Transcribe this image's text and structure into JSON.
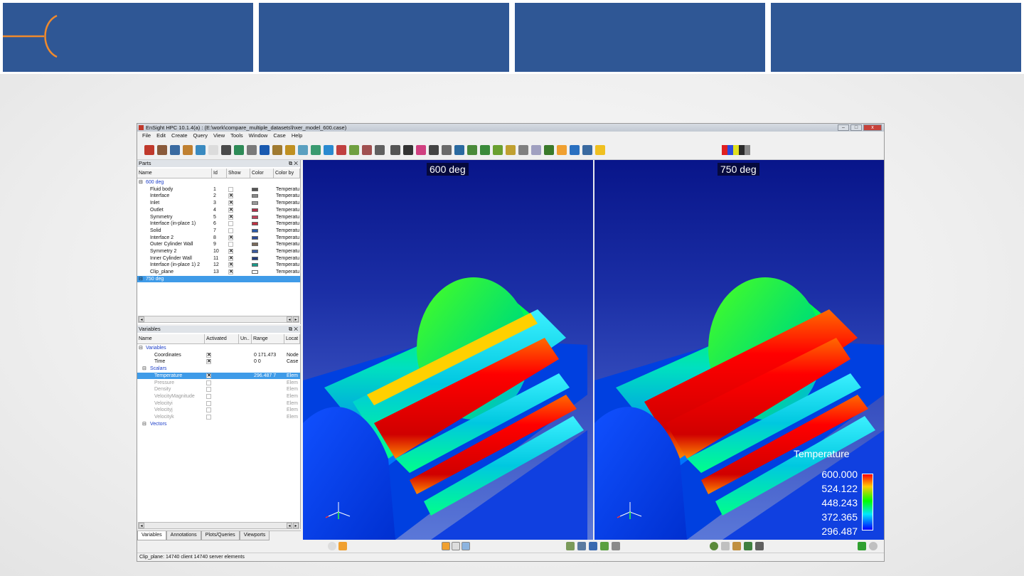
{
  "window": {
    "title": "EnSight HPC 10.1.4(a) :  (E:\\work\\compare_multiple_datasets\\hxer_model_600.case)"
  },
  "menu": [
    "File",
    "Edit",
    "Create",
    "Query",
    "View",
    "Tools",
    "Window",
    "Case",
    "Help"
  ],
  "parts": {
    "title": "Parts",
    "columns": [
      "Name",
      "Id",
      "Show",
      "Color",
      "Color by"
    ],
    "groups": [
      {
        "label": "600 deg",
        "selected": false
      },
      {
        "label": "750 deg",
        "selected": true
      }
    ],
    "rows": [
      {
        "name": "Fluid body",
        "id": "1",
        "show": false,
        "color": "#555555",
        "color_by": "Temperatu"
      },
      {
        "name": "Interface",
        "id": "2",
        "show": true,
        "color": "#8a8a8a",
        "color_by": "Temperatu"
      },
      {
        "name": "Inlet",
        "id": "3",
        "show": true,
        "color": "#9a9a9a",
        "color_by": "Temperatu"
      },
      {
        "name": "Outlet",
        "id": "4",
        "show": true,
        "color": "#b0304a",
        "color_by": "Temperatu"
      },
      {
        "name": "Symmetry",
        "id": "5",
        "show": true,
        "color": "#c0405a",
        "color_by": "Temperatu"
      },
      {
        "name": "Interface (in-place 1)",
        "id": "6",
        "show": false,
        "color": "#c03040",
        "color_by": "Temperatu"
      },
      {
        "name": "Solid",
        "id": "7",
        "show": false,
        "color": "#2a5aa8",
        "color_by": "Temperatu"
      },
      {
        "name": "Interface 2",
        "id": "8",
        "show": true,
        "color": "#2a4a98",
        "color_by": "Temperatu"
      },
      {
        "name": "Outer Cylinder Wall",
        "id": "9",
        "show": false,
        "color": "#7a6a5a",
        "color_by": "Temperatu"
      },
      {
        "name": "Symmetry 2",
        "id": "10",
        "show": true,
        "color": "#3a5aa0",
        "color_by": "Temperatu"
      },
      {
        "name": "Inner Cylinder Wall",
        "id": "11",
        "show": true,
        "color": "#223a78",
        "color_by": "Temperatu"
      },
      {
        "name": "Interface (in-place 1) 2",
        "id": "12",
        "show": true,
        "color": "#1a9a8a",
        "color_by": "Temperatu"
      },
      {
        "name": "Clip_plane",
        "id": "13",
        "show": true,
        "color": "#ffffff",
        "color_by": "Temperatu"
      }
    ]
  },
  "variables": {
    "title": "Variables",
    "columns": [
      "Name",
      "Activated",
      "Un..",
      "Range",
      "Locat"
    ],
    "rows": [
      {
        "name": "Variables",
        "kind": "grp"
      },
      {
        "name": "Coordinates",
        "kind": "leaf",
        "activated": true,
        "range": "0  171.473",
        "loc": "Node"
      },
      {
        "name": "Time",
        "kind": "leaf",
        "activated": true,
        "range": "0  0",
        "loc": "Case"
      },
      {
        "name": "Scalars",
        "kind": "sub"
      },
      {
        "name": "Temperature",
        "kind": "leaf2",
        "activated": true,
        "range": "296.487  7",
        "loc": "Elem",
        "selected": true
      },
      {
        "name": "Pressure",
        "kind": "leaf2",
        "activated": false,
        "loc": "Elem",
        "dim": true
      },
      {
        "name": "Density",
        "kind": "leaf2",
        "activated": false,
        "loc": "Elem",
        "dim": true
      },
      {
        "name": "VelocityMagnitude",
        "kind": "leaf2",
        "activated": false,
        "loc": "Elem",
        "dim": true
      },
      {
        "name": "Velocityi",
        "kind": "leaf2",
        "activated": false,
        "loc": "Elem",
        "dim": true
      },
      {
        "name": "Velocityj",
        "kind": "leaf2",
        "activated": false,
        "loc": "Elem",
        "dim": true
      },
      {
        "name": "Velocityk",
        "kind": "leaf2",
        "activated": false,
        "loc": "Elem",
        "dim": true
      },
      {
        "name": "Vectors",
        "kind": "sub"
      }
    ]
  },
  "tabs": [
    "Variables",
    "Annotations",
    "Plots/Queries",
    "Viewports"
  ],
  "viewports": [
    {
      "label": "600 deg"
    },
    {
      "label": "750 deg"
    }
  ],
  "legend": {
    "title": "Temperature",
    "values": [
      "600.000",
      "524.122",
      "448.243",
      "372.365",
      "296.487"
    ]
  },
  "status": "Clip_plane: 14740 client 14740 server elements",
  "colors": {
    "banner": "#2f5795",
    "accent": "#f08a2c",
    "selection": "#3f9be8"
  }
}
